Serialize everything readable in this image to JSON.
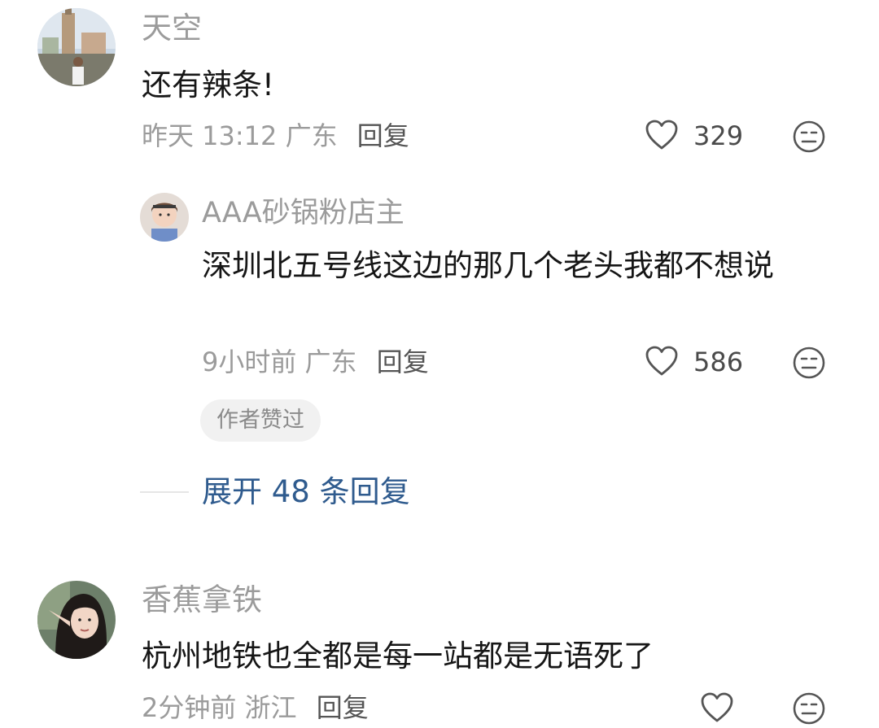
{
  "comments": [
    {
      "user": "天空",
      "text": "还有辣条!",
      "time": "昨天 13:12",
      "location": "广东",
      "reply_label": "回复",
      "likes": "329",
      "replies": [
        {
          "user": "AAA砂锅粉店主",
          "text": "深圳北五号线这边的那几个老头我都不想说",
          "time": "9小时前",
          "location": "广东",
          "reply_label": "回复",
          "likes": "586",
          "badge": "作者赞过"
        }
      ],
      "expand_label": "展开 48 条回复"
    },
    {
      "user": "香蕉拿铁",
      "text": "杭州地铁也全都是每一站都是无语死了",
      "time": "2分钟前",
      "location": "浙江",
      "reply_label": "回复",
      "likes": ""
    }
  ],
  "colors": {
    "link": "#2f5b8e",
    "muted": "#9b9b9b",
    "text": "#161616"
  }
}
